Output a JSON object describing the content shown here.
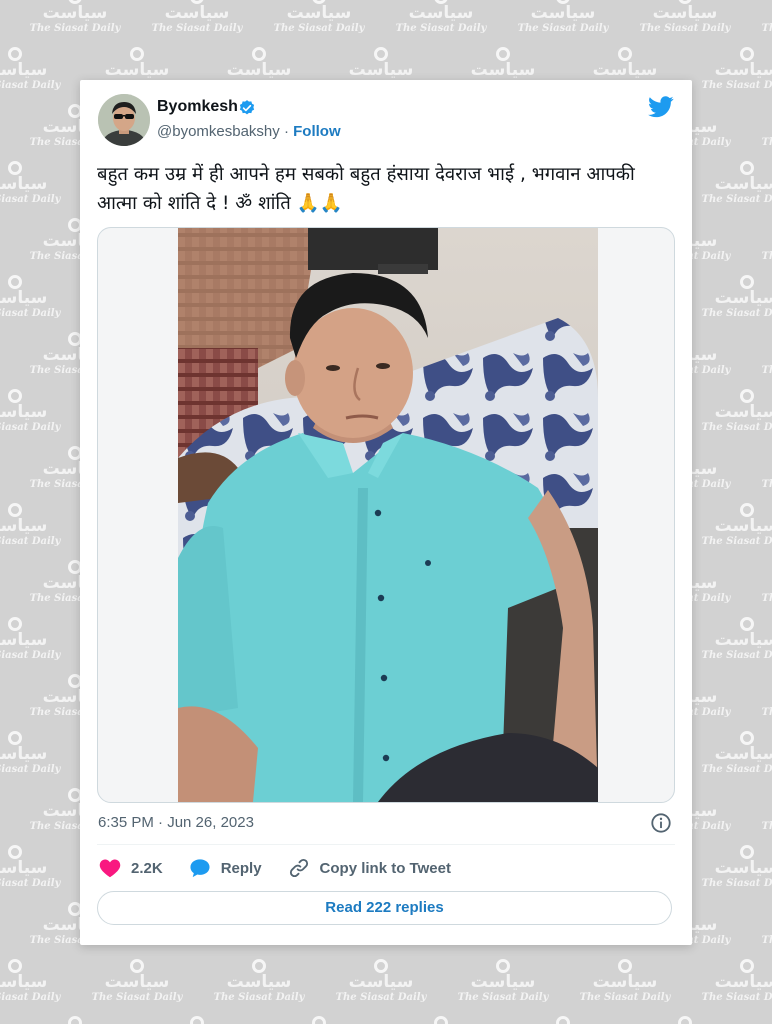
{
  "watermark": {
    "brand_urdu": "سیاست",
    "brand_english": "The Siasat Daily"
  },
  "tweet": {
    "author_name": "Byomkesh",
    "handle": "@byomkesbakshy",
    "separator": "·",
    "follow_label": "Follow",
    "text": "बहुत कम उम्र में ही आपने हम सबको बहुत हंसाया देवराज भाई , भगवान आपकी आत्मा को शांति दे ! ॐ शांति",
    "text_emoji": "🙏🙏",
    "timestamp": "6:35 PM · Jun 26, 2023",
    "likes_count": "2.2K",
    "reply_label": "Reply",
    "copy_link_label": "Copy link to Tweet",
    "read_replies_label": "Read 222 replies"
  },
  "colors": {
    "twitter_blue": "#1d9bf0",
    "link_blue": "#1d7bc1",
    "like_pink": "#f91880",
    "muted_text": "#536471",
    "background": "#d2d2d2"
  },
  "icons": {
    "verified": "verified-badge-icon",
    "logo": "twitter-bird-icon",
    "like": "heart-icon",
    "reply": "speech-bubble-icon",
    "copy": "link-icon",
    "info": "info-icon"
  }
}
